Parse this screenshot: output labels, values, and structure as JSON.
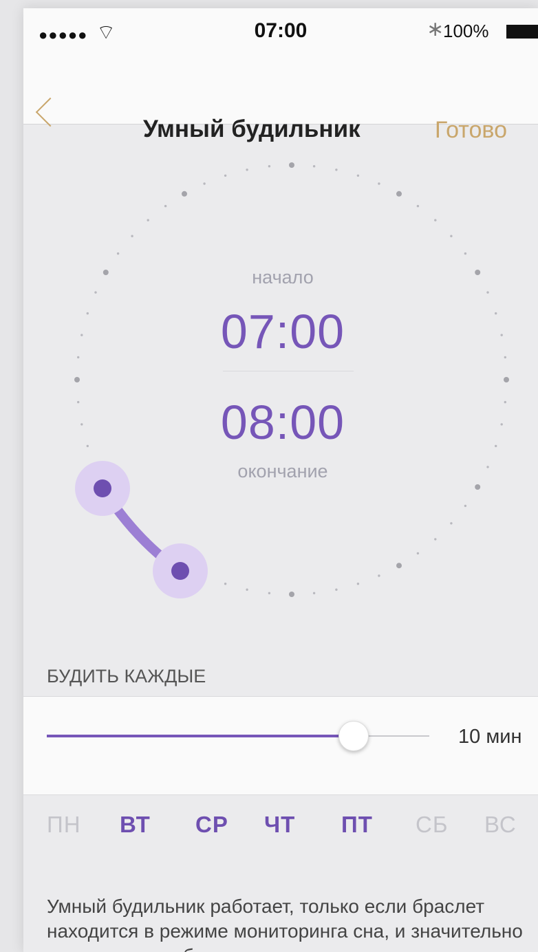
{
  "status_bar": {
    "signal": "●●●●●",
    "time": "07:00",
    "battery_percent": "100%"
  },
  "nav": {
    "title": "Умный будильник",
    "done_label": "Готово"
  },
  "alarm": {
    "start_label": "начало",
    "start_time": "07:00",
    "end_time": "08:00",
    "end_label": "окончание"
  },
  "interval": {
    "section_label": "БУДИТЬ КАЖДЫЕ",
    "value_label": "10 мин",
    "slider_fraction": 0.8
  },
  "days": [
    {
      "label": "ПН",
      "active": false
    },
    {
      "label": "ВТ",
      "active": true
    },
    {
      "label": "СР",
      "active": true
    },
    {
      "label": "ЧТ",
      "active": true
    },
    {
      "label": "ПТ",
      "active": true
    },
    {
      "label": "СБ",
      "active": false
    },
    {
      "label": "ВС",
      "active": false
    }
  ],
  "note": "Умный будильник работает, только если браслет находится в режиме мониторинга сна, и значительно снижает заряд браслета.",
  "colors": {
    "accent": "#7656b8",
    "gold": "#c9a66b",
    "handle_glow": "#d8c8f0"
  }
}
